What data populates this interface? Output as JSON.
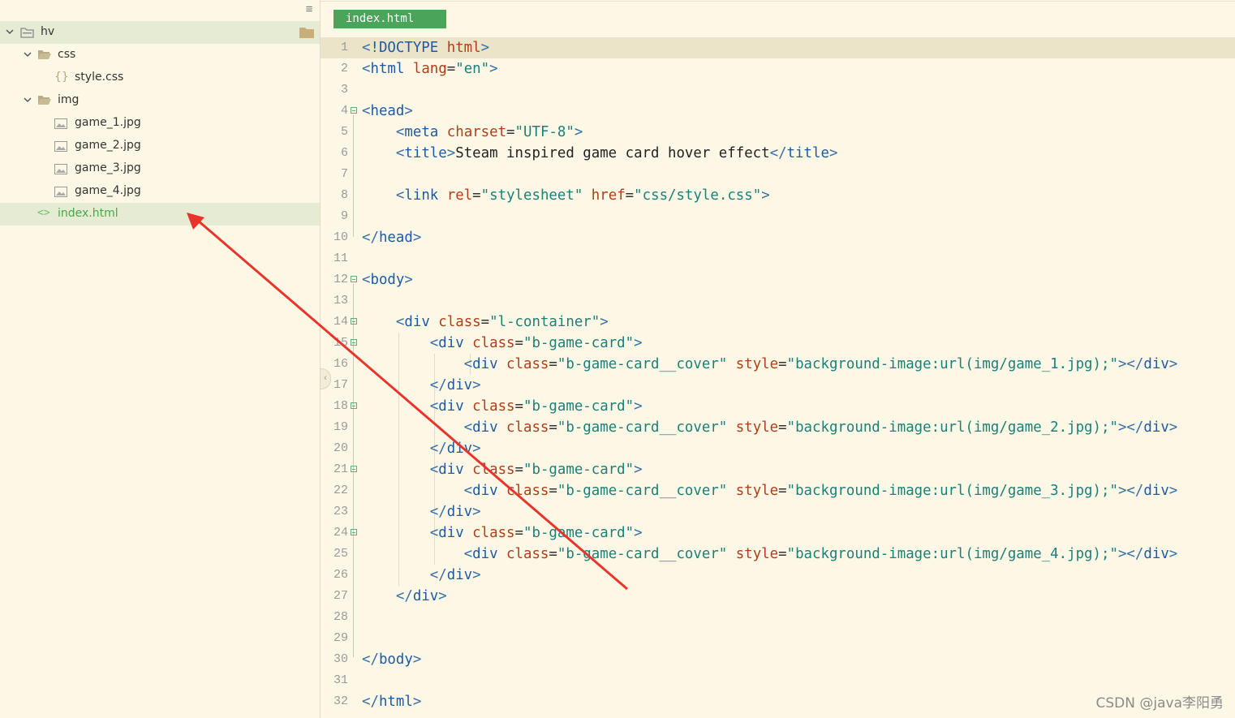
{
  "sidebar": {
    "items": [
      {
        "label": "hv",
        "type": "project"
      },
      {
        "label": "css",
        "type": "folder"
      },
      {
        "label": "style.css",
        "type": "css-file"
      },
      {
        "label": "img",
        "type": "folder"
      },
      {
        "label": "game_1.jpg",
        "type": "image-file"
      },
      {
        "label": "game_2.jpg",
        "type": "image-file"
      },
      {
        "label": "game_3.jpg",
        "type": "image-file"
      },
      {
        "label": "game_4.jpg",
        "type": "image-file"
      },
      {
        "label": "index.html",
        "type": "html-file",
        "selected": true
      }
    ]
  },
  "tab": {
    "label": "index.html"
  },
  "editor": {
    "lines": [
      {
        "n": "1",
        "fold": false,
        "tokens": [
          [
            "tk-bracket",
            "<"
          ],
          [
            "tk-doc",
            "!DOCTYPE"
          ],
          [
            "tk-text",
            " "
          ],
          [
            "tk-attr",
            "html"
          ],
          [
            "tk-bracket",
            ">"
          ]
        ]
      },
      {
        "n": "2",
        "fold": false,
        "tokens": [
          [
            "tk-bracket",
            "<"
          ],
          [
            "tk-tag",
            "html"
          ],
          [
            "tk-text",
            " "
          ],
          [
            "tk-attr",
            "lang"
          ],
          [
            "tk-eq",
            "="
          ],
          [
            "tk-val",
            "\"en\""
          ],
          [
            "tk-bracket",
            ">"
          ]
        ]
      },
      {
        "n": "3",
        "fold": false,
        "tokens": []
      },
      {
        "n": "4",
        "fold": true,
        "tokens": [
          [
            "tk-bracket",
            "<"
          ],
          [
            "tk-tag",
            "head"
          ],
          [
            "tk-bracket",
            ">"
          ]
        ]
      },
      {
        "n": "5",
        "fold": false,
        "tokens": [
          [
            "tk-text",
            "    "
          ],
          [
            "tk-bracket",
            "<"
          ],
          [
            "tk-tag",
            "meta"
          ],
          [
            "tk-text",
            " "
          ],
          [
            "tk-attr",
            "charset"
          ],
          [
            "tk-eq",
            "="
          ],
          [
            "tk-val",
            "\"UTF-8\""
          ],
          [
            "tk-bracket",
            ">"
          ]
        ]
      },
      {
        "n": "6",
        "fold": false,
        "tokens": [
          [
            "tk-text",
            "    "
          ],
          [
            "tk-bracket",
            "<"
          ],
          [
            "tk-tag",
            "title"
          ],
          [
            "tk-bracket",
            ">"
          ],
          [
            "tk-text",
            "Steam inspired game card hover effect"
          ],
          [
            "tk-bracket",
            "</"
          ],
          [
            "tk-tag",
            "title"
          ],
          [
            "tk-bracket",
            ">"
          ]
        ]
      },
      {
        "n": "7",
        "fold": false,
        "tokens": []
      },
      {
        "n": "8",
        "fold": false,
        "tokens": [
          [
            "tk-text",
            "    "
          ],
          [
            "tk-bracket",
            "<"
          ],
          [
            "tk-tag",
            "link"
          ],
          [
            "tk-text",
            " "
          ],
          [
            "tk-attr",
            "rel"
          ],
          [
            "tk-eq",
            "="
          ],
          [
            "tk-val",
            "\"stylesheet\""
          ],
          [
            "tk-text",
            " "
          ],
          [
            "tk-attr",
            "href"
          ],
          [
            "tk-eq",
            "="
          ],
          [
            "tk-val",
            "\"css/style.css\""
          ],
          [
            "tk-bracket",
            ">"
          ]
        ]
      },
      {
        "n": "9",
        "fold": false,
        "tokens": []
      },
      {
        "n": "10",
        "fold": false,
        "tokens": [
          [
            "tk-bracket",
            "</"
          ],
          [
            "tk-tag",
            "head"
          ],
          [
            "tk-bracket",
            ">"
          ]
        ]
      },
      {
        "n": "11",
        "fold": false,
        "tokens": []
      },
      {
        "n": "12",
        "fold": true,
        "tokens": [
          [
            "tk-bracket",
            "<"
          ],
          [
            "tk-tag",
            "body"
          ],
          [
            "tk-bracket",
            ">"
          ]
        ]
      },
      {
        "n": "13",
        "fold": false,
        "tokens": []
      },
      {
        "n": "14",
        "fold": true,
        "tokens": [
          [
            "tk-text",
            "    "
          ],
          [
            "tk-bracket",
            "<"
          ],
          [
            "tk-tag",
            "div"
          ],
          [
            "tk-text",
            " "
          ],
          [
            "tk-attr",
            "class"
          ],
          [
            "tk-eq",
            "="
          ],
          [
            "tk-val",
            "\"l-container\""
          ],
          [
            "tk-bracket",
            ">"
          ]
        ]
      },
      {
        "n": "15",
        "fold": true,
        "tokens": [
          [
            "tk-text",
            "        "
          ],
          [
            "tk-bracket",
            "<"
          ],
          [
            "tk-tag",
            "div"
          ],
          [
            "tk-text",
            " "
          ],
          [
            "tk-attr",
            "class"
          ],
          [
            "tk-eq",
            "="
          ],
          [
            "tk-val",
            "\"b-game-card\""
          ],
          [
            "tk-bracket",
            ">"
          ]
        ]
      },
      {
        "n": "16",
        "fold": false,
        "tokens": [
          [
            "tk-text",
            "            "
          ],
          [
            "tk-bracket",
            "<"
          ],
          [
            "tk-tag",
            "div"
          ],
          [
            "tk-text",
            " "
          ],
          [
            "tk-attr",
            "class"
          ],
          [
            "tk-eq",
            "="
          ],
          [
            "tk-val",
            "\"b-game-card__cover\""
          ],
          [
            "tk-text",
            " "
          ],
          [
            "tk-attr",
            "style"
          ],
          [
            "tk-eq",
            "="
          ],
          [
            "tk-val",
            "\"background-image:url(img/game_1.jpg);\""
          ],
          [
            "tk-bracket",
            "></"
          ],
          [
            "tk-tag",
            "div"
          ],
          [
            "tk-bracket",
            ">"
          ]
        ]
      },
      {
        "n": "17",
        "fold": false,
        "tokens": [
          [
            "tk-text",
            "        "
          ],
          [
            "tk-bracket",
            "</"
          ],
          [
            "tk-tag",
            "div"
          ],
          [
            "tk-bracket",
            ">"
          ]
        ]
      },
      {
        "n": "18",
        "fold": true,
        "tokens": [
          [
            "tk-text",
            "        "
          ],
          [
            "tk-bracket",
            "<"
          ],
          [
            "tk-tag",
            "div"
          ],
          [
            "tk-text",
            " "
          ],
          [
            "tk-attr",
            "class"
          ],
          [
            "tk-eq",
            "="
          ],
          [
            "tk-val",
            "\"b-game-card\""
          ],
          [
            "tk-bracket",
            ">"
          ]
        ]
      },
      {
        "n": "19",
        "fold": false,
        "tokens": [
          [
            "tk-text",
            "            "
          ],
          [
            "tk-bracket",
            "<"
          ],
          [
            "tk-tag",
            "div"
          ],
          [
            "tk-text",
            " "
          ],
          [
            "tk-attr",
            "class"
          ],
          [
            "tk-eq",
            "="
          ],
          [
            "tk-val",
            "\"b-game-card__cover\""
          ],
          [
            "tk-text",
            " "
          ],
          [
            "tk-attr",
            "style"
          ],
          [
            "tk-eq",
            "="
          ],
          [
            "tk-val",
            "\"background-image:url(img/game_2.jpg);\""
          ],
          [
            "tk-bracket",
            "></"
          ],
          [
            "tk-tag",
            "div"
          ],
          [
            "tk-bracket",
            ">"
          ]
        ]
      },
      {
        "n": "20",
        "fold": false,
        "tokens": [
          [
            "tk-text",
            "        "
          ],
          [
            "tk-bracket",
            "</"
          ],
          [
            "tk-tag",
            "div"
          ],
          [
            "tk-bracket",
            ">"
          ]
        ]
      },
      {
        "n": "21",
        "fold": true,
        "tokens": [
          [
            "tk-text",
            "        "
          ],
          [
            "tk-bracket",
            "<"
          ],
          [
            "tk-tag",
            "div"
          ],
          [
            "tk-text",
            " "
          ],
          [
            "tk-attr",
            "class"
          ],
          [
            "tk-eq",
            "="
          ],
          [
            "tk-val",
            "\"b-game-card\""
          ],
          [
            "tk-bracket",
            ">"
          ]
        ]
      },
      {
        "n": "22",
        "fold": false,
        "tokens": [
          [
            "tk-text",
            "            "
          ],
          [
            "tk-bracket",
            "<"
          ],
          [
            "tk-tag",
            "div"
          ],
          [
            "tk-text",
            " "
          ],
          [
            "tk-attr",
            "class"
          ],
          [
            "tk-eq",
            "="
          ],
          [
            "tk-val",
            "\"b-game-card__cover\""
          ],
          [
            "tk-text",
            " "
          ],
          [
            "tk-attr",
            "style"
          ],
          [
            "tk-eq",
            "="
          ],
          [
            "tk-val",
            "\"background-image:url(img/game_3.jpg);\""
          ],
          [
            "tk-bracket",
            "></"
          ],
          [
            "tk-tag",
            "div"
          ],
          [
            "tk-bracket",
            ">"
          ]
        ]
      },
      {
        "n": "23",
        "fold": false,
        "tokens": [
          [
            "tk-text",
            "        "
          ],
          [
            "tk-bracket",
            "</"
          ],
          [
            "tk-tag",
            "div"
          ],
          [
            "tk-bracket",
            ">"
          ]
        ]
      },
      {
        "n": "24",
        "fold": true,
        "tokens": [
          [
            "tk-text",
            "        "
          ],
          [
            "tk-bracket",
            "<"
          ],
          [
            "tk-tag",
            "div"
          ],
          [
            "tk-text",
            " "
          ],
          [
            "tk-attr",
            "class"
          ],
          [
            "tk-eq",
            "="
          ],
          [
            "tk-val",
            "\"b-game-card\""
          ],
          [
            "tk-bracket",
            ">"
          ]
        ]
      },
      {
        "n": "25",
        "fold": false,
        "tokens": [
          [
            "tk-text",
            "            "
          ],
          [
            "tk-bracket",
            "<"
          ],
          [
            "tk-tag",
            "div"
          ],
          [
            "tk-text",
            " "
          ],
          [
            "tk-attr",
            "class"
          ],
          [
            "tk-eq",
            "="
          ],
          [
            "tk-val",
            "\"b-game-card__cover\""
          ],
          [
            "tk-text",
            " "
          ],
          [
            "tk-attr",
            "style"
          ],
          [
            "tk-eq",
            "="
          ],
          [
            "tk-val",
            "\"background-image:url(img/game_4.jpg);\""
          ],
          [
            "tk-bracket",
            "></"
          ],
          [
            "tk-tag",
            "div"
          ],
          [
            "tk-bracket",
            ">"
          ]
        ]
      },
      {
        "n": "26",
        "fold": false,
        "tokens": [
          [
            "tk-text",
            "        "
          ],
          [
            "tk-bracket",
            "</"
          ],
          [
            "tk-tag",
            "div"
          ],
          [
            "tk-bracket",
            ">"
          ]
        ]
      },
      {
        "n": "27",
        "fold": false,
        "tokens": [
          [
            "tk-text",
            "    "
          ],
          [
            "tk-bracket",
            "</"
          ],
          [
            "tk-tag",
            "div"
          ],
          [
            "tk-bracket",
            ">"
          ]
        ]
      },
      {
        "n": "28",
        "fold": false,
        "tokens": []
      },
      {
        "n": "29",
        "fold": false,
        "tokens": []
      },
      {
        "n": "30",
        "fold": false,
        "tokens": [
          [
            "tk-bracket",
            "</"
          ],
          [
            "tk-tag",
            "body"
          ],
          [
            "tk-bracket",
            ">"
          ]
        ]
      },
      {
        "n": "31",
        "fold": false,
        "tokens": []
      },
      {
        "n": "32",
        "fold": false,
        "tokens": [
          [
            "tk-bracket",
            "</"
          ],
          [
            "tk-tag",
            "html"
          ],
          [
            "tk-bracket",
            ">"
          ]
        ]
      }
    ]
  },
  "watermark": "CSDN @java李阳勇",
  "colors": {
    "accent": "#4aa45a",
    "annotation_arrow": "#e8342b",
    "background": "#fdf8e6"
  }
}
